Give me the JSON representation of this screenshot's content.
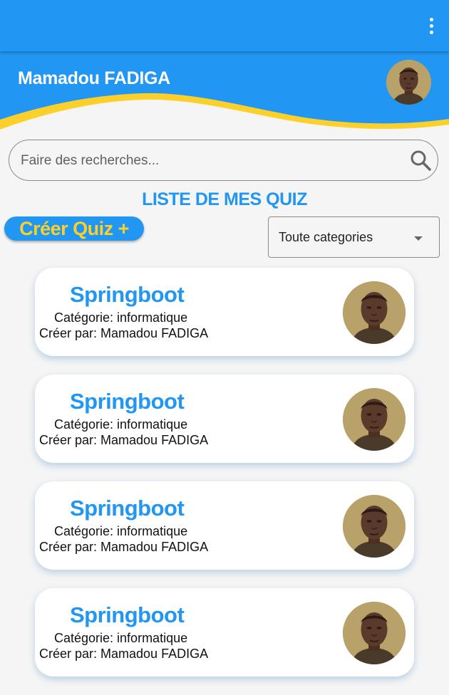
{
  "appbar": {
    "menu_icon": "more-vert-icon"
  },
  "header": {
    "user_name": "Mamadou FADIGA",
    "avatar_icon": "user-avatar"
  },
  "colors": {
    "primary": "#2196f3",
    "accent": "#fcd02a",
    "background": "#f5f5f5"
  },
  "search": {
    "placeholder": "Faire des recherches...",
    "value": "",
    "icon": "search-icon"
  },
  "section_title": "LISTE DE MES QUIZ",
  "create_button": {
    "label": "Créer Quiz +"
  },
  "category_select": {
    "value": "Toute categories",
    "icon": "dropdown-caret-icon"
  },
  "quizzes": [
    {
      "title": "Springboot",
      "category": "Catégorie: informatique",
      "author": "Créer par: Mamadou FADIGA"
    },
    {
      "title": "Springboot",
      "category": "Catégorie: informatique",
      "author": "Créer par: Mamadou FADIGA"
    },
    {
      "title": "Springboot",
      "category": "Catégorie: informatique",
      "author": "Créer par: Mamadou FADIGA"
    },
    {
      "title": "Springboot",
      "category": "Catégorie: informatique",
      "author": "Créer par: Mamadou FADIGA"
    }
  ]
}
